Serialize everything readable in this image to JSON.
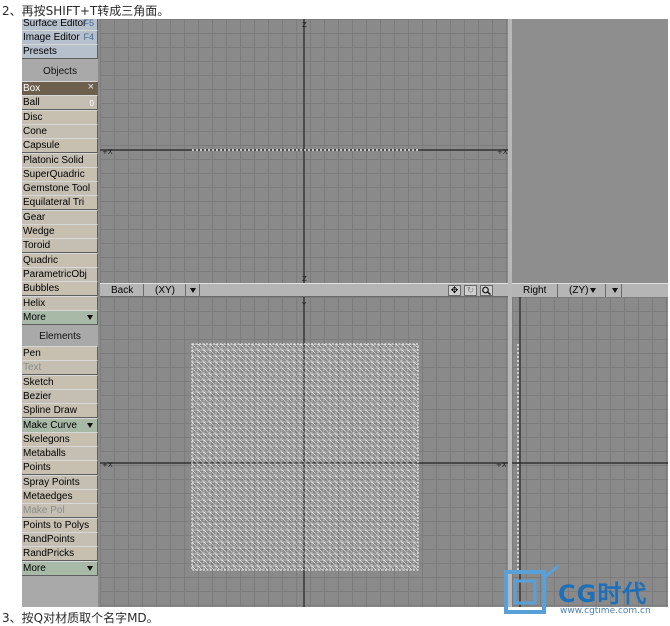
{
  "captions": {
    "top": "2、再按SHIFT+T转成三角面。",
    "bottom": "3、按Q对材质取个名字MD。"
  },
  "panel": {
    "top_buttons": [
      {
        "label": "Surface Editor",
        "hotkey": "F5"
      },
      {
        "label": "Image Editor",
        "hotkey": "F4"
      },
      {
        "label": "Presets",
        "hotkey": ""
      }
    ],
    "objects_header": "Objects",
    "objects": [
      {
        "label": "Box",
        "selected": true
      },
      {
        "label": "Ball",
        "badge": "0"
      },
      {
        "label": "Disc"
      },
      {
        "label": "Cone"
      },
      {
        "label": "Capsule"
      },
      {
        "label": "Platonic Solid"
      },
      {
        "label": "SuperQuadric"
      },
      {
        "label": "Gemstone Tool"
      },
      {
        "label": "Equilateral Tri"
      },
      {
        "label": "Gear"
      },
      {
        "label": "Wedge"
      },
      {
        "label": "Toroid"
      },
      {
        "label": "Quadric"
      },
      {
        "label": "ParametricObj"
      },
      {
        "label": "Bubbles"
      },
      {
        "label": "Helix"
      },
      {
        "label": "More",
        "menu": true
      }
    ],
    "elements_header": "Elements",
    "elements": [
      {
        "label": "Pen"
      },
      {
        "label": "Text",
        "disabled": true
      },
      {
        "label": "Sketch"
      },
      {
        "label": "Bezier"
      },
      {
        "label": "Spline Draw"
      },
      {
        "label": "Make Curve",
        "menu": true
      },
      {
        "label": "Skelegons"
      },
      {
        "label": "Metaballs"
      },
      {
        "label": "Points"
      },
      {
        "label": "Spray Points"
      },
      {
        "label": "Metaedges"
      },
      {
        "label": "Make Pol",
        "disabled": true
      },
      {
        "label": "Points to Polys"
      },
      {
        "label": "RandPoints"
      },
      {
        "label": "RandPricks"
      },
      {
        "label": "More",
        "menu": true
      }
    ]
  },
  "viewports": {
    "back": {
      "view": "Back",
      "axes": "(XY)"
    },
    "right": {
      "view": "Right",
      "axes": "(ZY)"
    }
  },
  "icons": {
    "move": "move-icon",
    "rotate": "rotate-icon",
    "zoom": "magnifier-icon"
  },
  "watermark": {
    "brand": "CG时代",
    "url": "www.cgtime.com.cn"
  }
}
